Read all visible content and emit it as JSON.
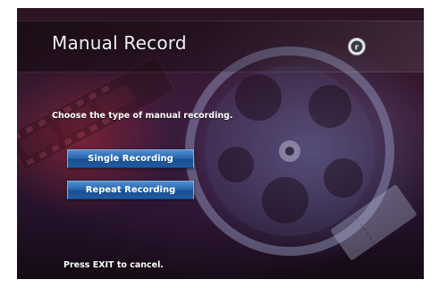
{
  "header": {
    "title": "Manual Record",
    "logo_icon": "circle-r-logo-icon",
    "logo_letter": "r"
  },
  "main": {
    "prompt": "Choose the type of manual recording.",
    "options": [
      {
        "label": "Single Recording"
      },
      {
        "label": "Repeat Recording"
      }
    ]
  },
  "footer": {
    "hint": "Press EXIT to cancel."
  },
  "colors": {
    "button_blue": "#2a67ae",
    "background_dark": "#2a1422",
    "accent_red": "#aa283c"
  },
  "decor": {
    "background_icon": "film-reel-icon"
  }
}
